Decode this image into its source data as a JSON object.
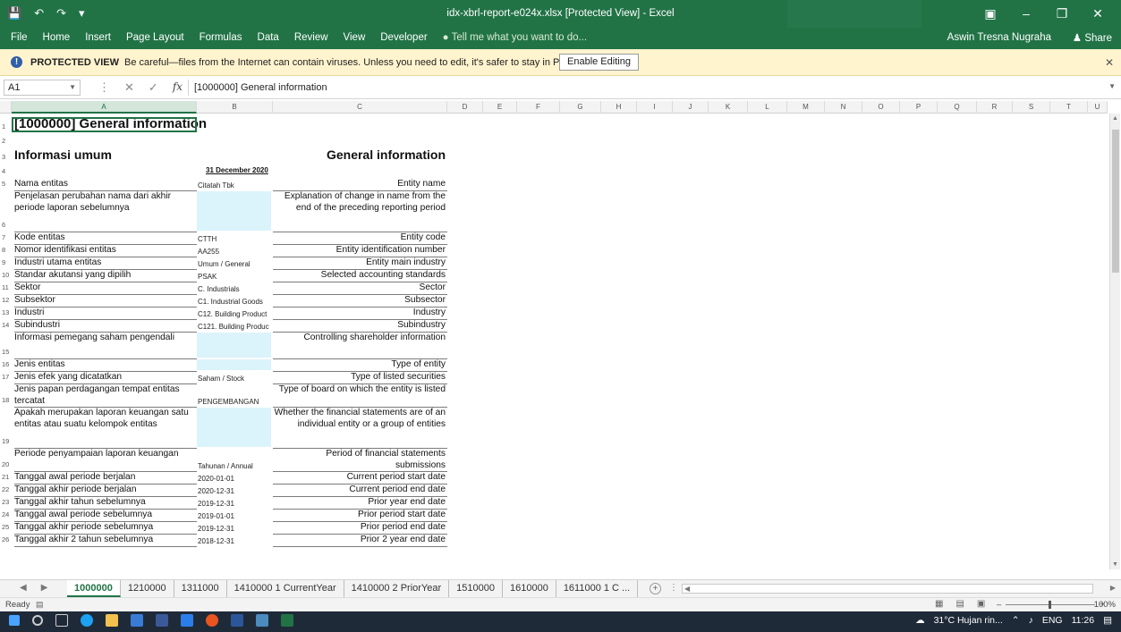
{
  "window": {
    "title": "idx-xbrl-report-e024x.xlsx  [Protected View]  -  Excel",
    "user": "Aswin Tresna Nugraha",
    "share": "Share"
  },
  "ribbon": {
    "tabs": [
      "File",
      "Home",
      "Insert",
      "Page Layout",
      "Formulas",
      "Data",
      "Review",
      "View",
      "Developer"
    ],
    "tell_me": "Tell me what you want to do..."
  },
  "protected": {
    "title": "PROTECTED VIEW",
    "message": "Be careful—files from the Internet can contain viruses. Unless you need to edit, it's safer to stay in Protected View.",
    "button": "Enable Editing"
  },
  "formula_bar": {
    "name_box": "A1",
    "formula": "[1000000] General information"
  },
  "columns": [
    "A",
    "B",
    "C",
    "D",
    "E",
    "F",
    "G",
    "H",
    "I",
    "J",
    "K",
    "L",
    "M",
    "N",
    "O",
    "P",
    "Q",
    "R",
    "S",
    "T",
    "U"
  ],
  "rows": {
    "title": "[1000000] General information",
    "left_header": "Informasi umum",
    "right_header": "General information",
    "date_header": "31 December 2020",
    "items": [
      {
        "n": "5",
        "id": "Nama entitas",
        "val": "Citatah Tbk",
        "en": "Entity name"
      },
      {
        "n": "6",
        "id": "Penjelasan perubahan nama dari akhir periode laporan sebelumnya",
        "val": "",
        "en": "Explanation of change in name from the end of the preceding reporting period"
      },
      {
        "n": "7",
        "id": "Kode entitas",
        "val": "CTTH",
        "en": "Entity code"
      },
      {
        "n": "8",
        "id": "Nomor identifikasi entitas",
        "val": "AA255",
        "en": "Entity identification number"
      },
      {
        "n": "9",
        "id": "Industri utama entitas",
        "val": "Umum / General",
        "en": "Entity main industry"
      },
      {
        "n": "10",
        "id": "Standar akutansi yang dipilih",
        "val": "PSAK",
        "en": "Selected accounting standards"
      },
      {
        "n": "11",
        "id": "Sektor",
        "val": "C. Industrials",
        "en": "Sector"
      },
      {
        "n": "12",
        "id": "Subsektor",
        "val": "C1. Industrial Goods",
        "en": "Subsector"
      },
      {
        "n": "13",
        "id": "Industri",
        "val": "C12. Building Product",
        "en": "Industry"
      },
      {
        "n": "14",
        "id": "Subindustri",
        "val": "C121. Building Produc",
        "en": "Subindustry"
      },
      {
        "n": "15",
        "id": "Informasi pemegang saham pengendali",
        "val": "",
        "en": "Controlling shareholder information"
      },
      {
        "n": "16",
        "id": "Jenis entitas",
        "val": "",
        "en": "Type of entity"
      },
      {
        "n": "17",
        "id": "Jenis efek yang dicatatkan",
        "val": "Saham / Stock",
        "en": "Type of listed securities"
      },
      {
        "n": "18",
        "id": "Jenis papan perdagangan tempat entitas tercatat",
        "val": "PENGEMBANGAN",
        "en": "Type of board on which the entity is listed"
      },
      {
        "n": "19",
        "id": "Apakah merupakan laporan keuangan satu entitas atau suatu kelompok entitas",
        "val": "",
        "en": "Whether the financial statements are of an individual entity or a group of entities"
      },
      {
        "n": "20",
        "id": "Periode penyampaian laporan keuangan",
        "val": "Tahunan / Annual",
        "en": "Period of financial statements submissions"
      },
      {
        "n": "21",
        "id": "Tanggal awal periode berjalan",
        "val": "2020-01-01",
        "en": "Current period start date"
      },
      {
        "n": "22",
        "id": "Tanggal akhir periode berjalan",
        "val": "2020-12-31",
        "en": "Current period end date"
      },
      {
        "n": "23",
        "id": "Tanggal akhir tahun sebelumnya",
        "val": "2019-12-31",
        "en": "Prior year end date"
      },
      {
        "n": "24",
        "id": "Tanggal awal periode sebelumnya",
        "val": "2019-01-01",
        "en": "Prior period start date"
      },
      {
        "n": "25",
        "id": "Tanggal akhir periode sebelumnya",
        "val": "2019-12-31",
        "en": "Prior period end date"
      },
      {
        "n": "26",
        "id": "Tanggal akhir 2 tahun sebelumnya",
        "val": "2018-12-31",
        "en": "Prior 2 year end date"
      }
    ]
  },
  "sheet_tabs": [
    "1000000",
    "1210000",
    "1311000",
    "1410000 1 CurrentYear",
    "1410000 2 PriorYear",
    "1510000",
    "1610000",
    "1611000 1 C ..."
  ],
  "status": {
    "ready": "Ready",
    "zoom": "100%"
  },
  "taskbar": {
    "weather": "31°C  Hujan rin...",
    "lang": "ENG",
    "time": "11:26"
  },
  "colors": {
    "excel_green": "#217346",
    "cell_fill": "#dbf3fb",
    "protected_bg": "#fff4ce"
  }
}
